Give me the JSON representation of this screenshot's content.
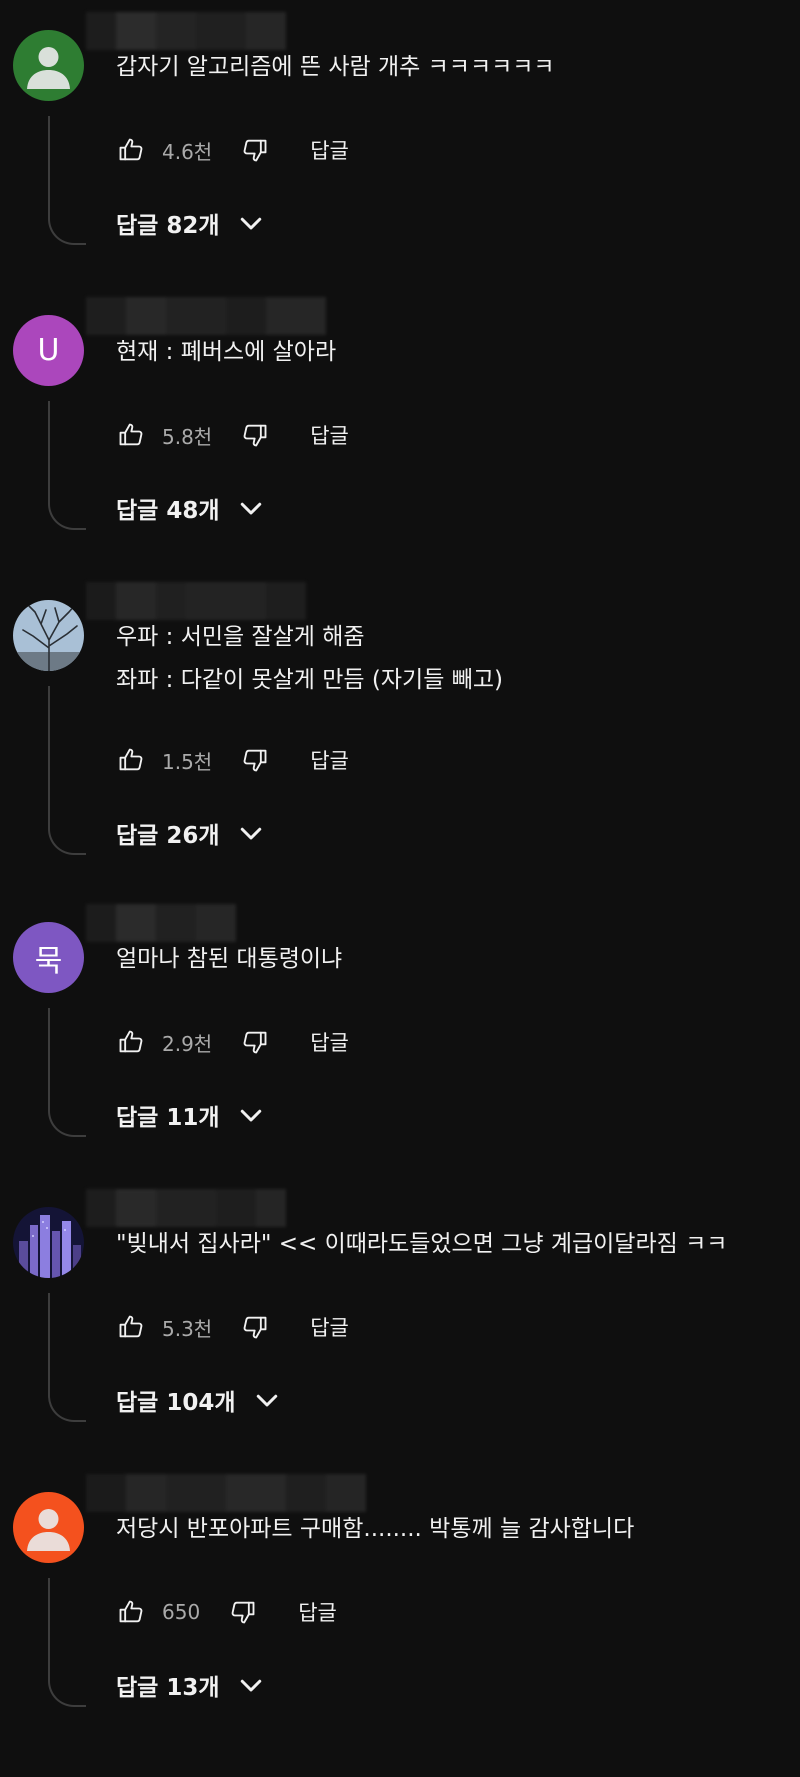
{
  "ui": {
    "reply_label": "답글"
  },
  "comments": [
    {
      "text": "갑자기 알고리즘에 뜬 사람 개추 ㅋㅋㅋㅋㅋㅋ",
      "likes": "4.6천",
      "replies": "답글 82개",
      "avatar": {
        "type": "default",
        "color": "#2e7d32"
      }
    },
    {
      "text": "현재 : 폐버스에 살아라",
      "likes": "5.8천",
      "replies": "답글 48개",
      "avatar": {
        "type": "letter",
        "letter": "U",
        "color": "#ab47bc"
      }
    },
    {
      "text": "우파 : 서민을 잘살게 해줌\n좌파 : 다같이 못살게 만듬 (자기들 빼고)",
      "likes": "1.5천",
      "replies": "답글 26개",
      "avatar": {
        "type": "photo-tree",
        "color": "#9fb6cc"
      }
    },
    {
      "text": "얼마나 참된 대통령이냐",
      "likes": "2.9천",
      "replies": "답글 11개",
      "avatar": {
        "type": "letter",
        "letter": "묵",
        "color": "#7e57c2"
      }
    },
    {
      "text": "\"빚내서 집사라\" << 이때라도들었으면 그냥 계급이달라짐 ㅋㅋ",
      "likes": "5.3천",
      "replies": "답글 104개",
      "avatar": {
        "type": "photo-city",
        "color": "#1a1a3a"
      }
    },
    {
      "text": "저당시 반포아파트 구매함........ 박통께 늘 감사합니다",
      "likes": "650",
      "replies": "답글 13개",
      "avatar": {
        "type": "default",
        "color": "#f4511e"
      }
    }
  ]
}
